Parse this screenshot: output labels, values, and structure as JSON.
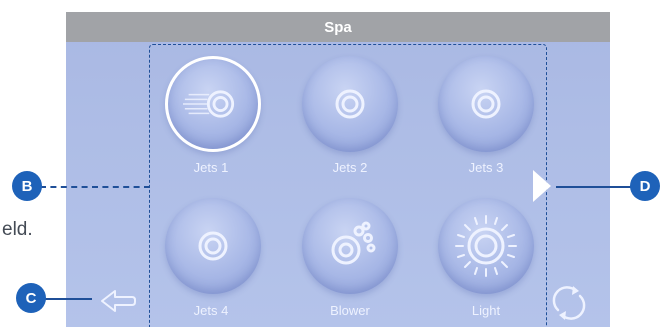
{
  "screen": {
    "title": "Spa",
    "buttons": [
      {
        "label": "Jets 1",
        "icon": "jet-icon",
        "active": true
      },
      {
        "label": "Jets 2",
        "icon": "jet-icon",
        "active": false
      },
      {
        "label": "Jets 3",
        "icon": "jet-icon",
        "active": false
      },
      {
        "label": "Jets 4",
        "icon": "jet-icon",
        "active": false
      },
      {
        "label": "Blower",
        "icon": "blower-icon",
        "active": false
      },
      {
        "label": "Light",
        "icon": "light-icon",
        "active": false
      }
    ],
    "nav_right_icon": "play-arrow-icon",
    "back_icon": "back-arrow-icon",
    "refresh_icon": "refresh-icon"
  },
  "callouts": {
    "b": "B",
    "c": "C",
    "d": "D"
  },
  "stray_text": "eld.",
  "colors": {
    "screen_bg": "#aebde6",
    "title_bar": "#a1a3a7",
    "callout": "#1e62b9",
    "outline": "#1f4f98"
  }
}
